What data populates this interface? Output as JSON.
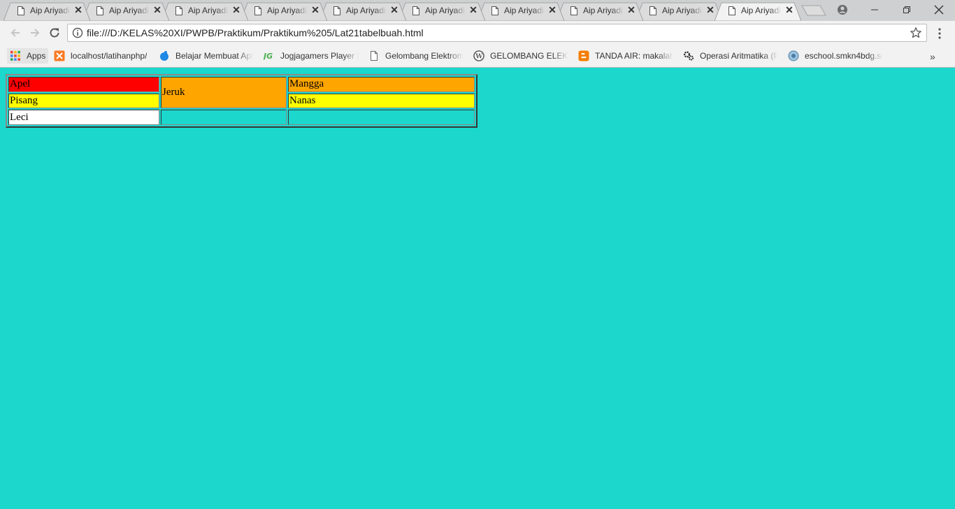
{
  "browser": {
    "tabs": [
      {
        "title": "Aip Ariyadi",
        "active": false
      },
      {
        "title": "Aip Ariyadi",
        "active": false
      },
      {
        "title": "Aip Ariyadi",
        "active": false
      },
      {
        "title": "Aip Ariyadi",
        "active": false
      },
      {
        "title": "Aip Ariyadi",
        "active": false
      },
      {
        "title": "Aip Ariyadi",
        "active": false
      },
      {
        "title": "Aip Ariyadi",
        "active": false
      },
      {
        "title": "Aip Ariyadi",
        "active": false
      },
      {
        "title": "Aip Ariyadi",
        "active": false
      },
      {
        "title": "Aip Ariyadi",
        "active": true
      }
    ],
    "address_bar": {
      "url": "file:///D:/KELAS%20XI/PWPB/Praktikum/Praktikum%205/Lat21tabelbuah.html"
    },
    "bookmarks": [
      {
        "label": "Apps",
        "icon": "apps-grid-icon"
      },
      {
        "label": "localhost/latihanphp/",
        "icon": "xampp-icon"
      },
      {
        "label": "Belajar Membuat Apl",
        "icon": "blue-blob-icon"
      },
      {
        "label": "Jogjagamers Player P",
        "icon": "jg-icon"
      },
      {
        "label": "Gelombang Elektrom",
        "icon": "page-icon"
      },
      {
        "label": "GELOMBANG ELEKTR",
        "icon": "wordpress-icon"
      },
      {
        "label": "TANDA AIR: makalah",
        "icon": "blogger-icon"
      },
      {
        "label": "Operasi Aritmatika (P",
        "icon": "gears-icon"
      },
      {
        "label": "eschool.smkn4bdg.sc",
        "icon": "school-logo-icon"
      }
    ],
    "bookmarks_overflow": "»"
  },
  "page": {
    "background": "#1bd7cc",
    "table": {
      "apel": "Apel",
      "jeruk": "Jeruk",
      "mangga": "Mangga",
      "pisang": "Pisang",
      "nanas": "Nanas",
      "leci": "Leci",
      "colors": {
        "apel": "#ff0000",
        "jeruk": "#ffa500",
        "mangga": "#ffa500",
        "pisang": "#ffff00",
        "nanas": "#ffff00",
        "leci": "#ffffff"
      }
    }
  }
}
